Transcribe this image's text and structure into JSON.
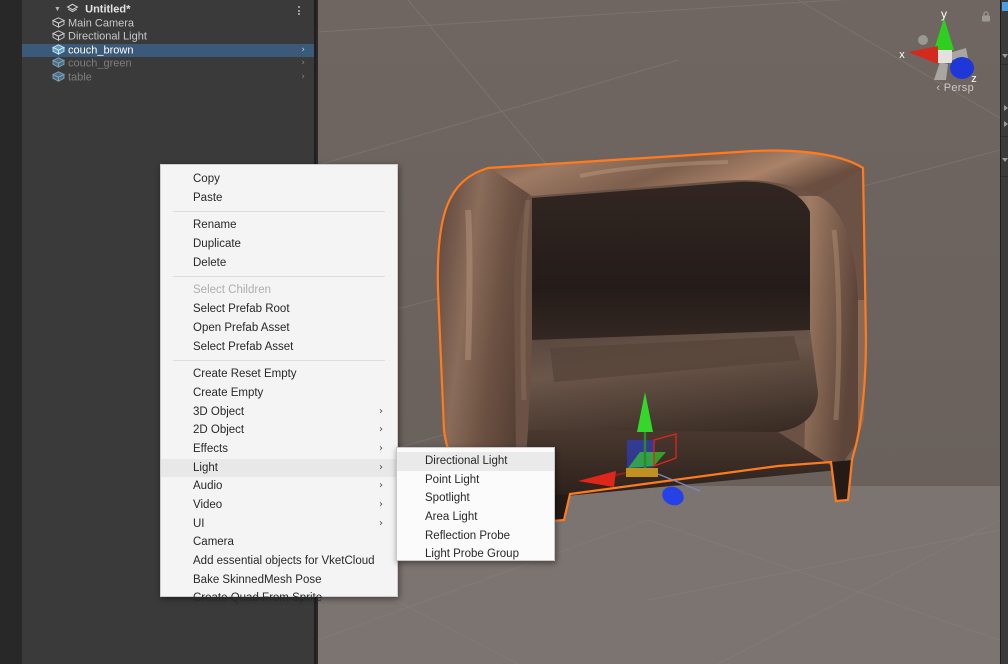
{
  "hierarchy": {
    "scene_row": {
      "label": "Untitled*",
      "icon": "scene-icon",
      "foldout": "▼",
      "menu_icon": "kebab-icon"
    },
    "items": [
      {
        "label": "Main Camera",
        "icon": "gameobject-cube-icon",
        "state": "normal",
        "expandable": false
      },
      {
        "label": "Directional Light",
        "icon": "gameobject-cube-icon",
        "state": "normal",
        "expandable": false
      },
      {
        "label": "couch_brown",
        "icon": "prefab-cube-icon",
        "state": "selected",
        "expandable": true,
        "chevron": "›"
      },
      {
        "label": "couch_green",
        "icon": "prefab-cube-icon",
        "state": "dimmed",
        "expandable": true,
        "chevron": "›"
      },
      {
        "label": "table",
        "icon": "prefab-cube-icon",
        "state": "dimmed",
        "expandable": true,
        "chevron": "›"
      }
    ]
  },
  "scene_view": {
    "projection_label": "Persp",
    "projection_prefix": "‹",
    "gizmo": {
      "axis_x_label": "x",
      "axis_y_label": "y",
      "axis_z_label": "z",
      "color_x": "#d42a1e",
      "color_y": "#2ecf20",
      "color_z": "#1f37d8"
    },
    "selection_outline_color": "#ff7b1e",
    "move_gizmo": {
      "color_x": "#e0261a",
      "color_y": "#34d82a",
      "color_z": "#2741e8"
    },
    "lock_icon": "lock-icon"
  },
  "context_menu": {
    "groups": [
      [
        {
          "label": "Copy",
          "state": "normal",
          "submenu": false
        },
        {
          "label": "Paste",
          "state": "normal",
          "submenu": false
        }
      ],
      [
        {
          "label": "Rename",
          "state": "normal",
          "submenu": false
        },
        {
          "label": "Duplicate",
          "state": "normal",
          "submenu": false
        },
        {
          "label": "Delete",
          "state": "normal",
          "submenu": false
        }
      ],
      [
        {
          "label": "Select Children",
          "state": "disabled",
          "submenu": false
        },
        {
          "label": "Select Prefab Root",
          "state": "normal",
          "submenu": false
        },
        {
          "label": "Open Prefab Asset",
          "state": "normal",
          "submenu": false
        },
        {
          "label": "Select Prefab Asset",
          "state": "normal",
          "submenu": false
        }
      ],
      [
        {
          "label": "Create Reset Empty",
          "state": "normal",
          "submenu": false
        },
        {
          "label": "Create Empty",
          "state": "normal",
          "submenu": false
        },
        {
          "label": "3D Object",
          "state": "normal",
          "submenu": true,
          "arrow": "›"
        },
        {
          "label": "2D Object",
          "state": "normal",
          "submenu": true,
          "arrow": "›"
        },
        {
          "label": "Effects",
          "state": "normal",
          "submenu": true,
          "arrow": "›"
        },
        {
          "label": "Light",
          "state": "highlighted",
          "submenu": true,
          "arrow": "›"
        },
        {
          "label": "Audio",
          "state": "normal",
          "submenu": true,
          "arrow": "›"
        },
        {
          "label": "Video",
          "state": "normal",
          "submenu": true,
          "arrow": "›"
        },
        {
          "label": "UI",
          "state": "normal",
          "submenu": true,
          "arrow": "›"
        },
        {
          "label": "Camera",
          "state": "normal",
          "submenu": false
        },
        {
          "label": "Add essential objects for VketCloud",
          "state": "normal",
          "submenu": false
        },
        {
          "label": "Bake SkinnedMesh Pose",
          "state": "normal",
          "submenu": false
        },
        {
          "label": "Create Quad From Sprite",
          "state": "normal",
          "submenu": false
        }
      ]
    ]
  },
  "submenu": {
    "parent": "Light",
    "items": [
      {
        "label": "Directional Light",
        "state": "highlighted"
      },
      {
        "label": "Point Light",
        "state": "normal"
      },
      {
        "label": "Spotlight",
        "state": "normal"
      },
      {
        "label": "Area Light",
        "state": "normal"
      },
      {
        "label": "Reflection Probe",
        "state": "normal"
      },
      {
        "label": "Light Probe Group",
        "state": "normal"
      }
    ]
  }
}
